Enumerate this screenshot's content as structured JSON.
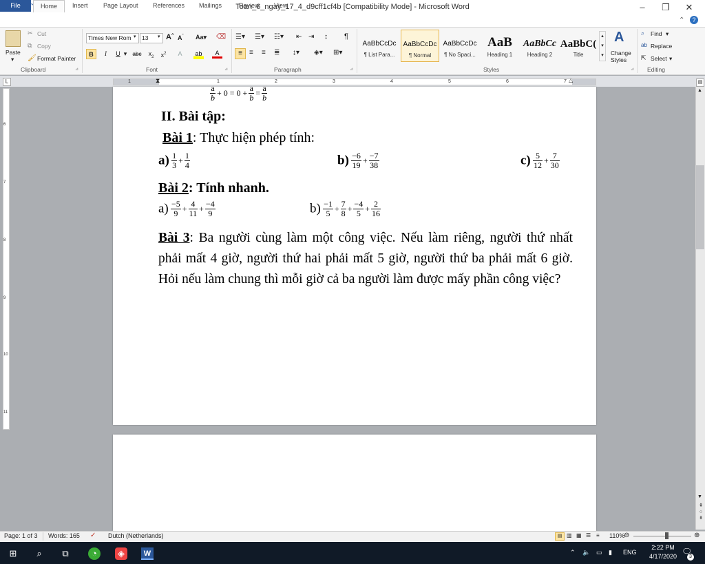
{
  "window": {
    "title": "Toan_6_ngay_17_4_d9cff1cf4b [Compatibility Mode] - Microsoft Word",
    "minimize_icon": "minimize-icon",
    "maximize_icon": "restore-icon",
    "close_icon": "close-icon"
  },
  "tabs": [
    "File",
    "Home",
    "Insert",
    "Page Layout",
    "References",
    "Mailings",
    "Review",
    "View"
  ],
  "ribbon": {
    "clipboard": {
      "paste": "Paste",
      "cut": "Cut",
      "copy": "Copy",
      "format_painter": "Format Painter",
      "group_label": "Clipboard"
    },
    "font": {
      "font_name": "Times New Rom",
      "font_size": "13",
      "group_label": "Font"
    },
    "paragraph": {
      "group_label": "Paragraph"
    },
    "styles": {
      "items": [
        {
          "preview": "AaBbCcDc",
          "name": "¶ List Para..."
        },
        {
          "preview": "AaBbCcDc",
          "name": "¶ Normal"
        },
        {
          "preview": "AaBbCcDc",
          "name": "¶ No Spaci..."
        },
        {
          "preview": "AaB",
          "name": "Heading 1"
        },
        {
          "preview": "AaBbCc",
          "name": "Heading 2"
        },
        {
          "preview": "AaBbC(",
          "name": "Title"
        }
      ],
      "change_styles_1": "Change",
      "change_styles_2": "Styles",
      "group_label": "Styles"
    },
    "editing": {
      "find": "Find",
      "replace": "Replace",
      "select": "Select",
      "group_label": "Editing"
    }
  },
  "ruler": {
    "h_numbers": [
      "1",
      "1",
      "2",
      "3",
      "4",
      "5",
      "6",
      "7"
    ],
    "v_numbers": [
      "6",
      "7",
      "8",
      "9",
      "10",
      "11"
    ]
  },
  "document": {
    "top_formula": {
      "a": "a",
      "b": "b",
      "mid": "+ 0 = 0 +",
      "eq": "="
    },
    "section_heading": "II. Bài tập:",
    "bai1": {
      "title": "Bài 1",
      "text": ": Thực hiện phép tính:",
      "a_label": "a)",
      "a": [
        {
          "n": "1",
          "d": "3"
        },
        {
          "n": "1",
          "d": "4"
        }
      ],
      "b_label": "b)",
      "b": [
        {
          "n": "−6",
          "d": "19"
        },
        {
          "n": "−7",
          "d": "38"
        }
      ],
      "c_label": "c)",
      "c": [
        {
          "n": "5",
          "d": "12"
        },
        {
          "n": "7",
          "d": "30"
        }
      ]
    },
    "bai2": {
      "title": "Bài 2",
      "text": ": Tính nhanh.",
      "a_label": "a)",
      "a": [
        {
          "n": "−5",
          "d": "9"
        },
        {
          "n": "4",
          "d": "11"
        },
        {
          "n": "−4",
          "d": "9"
        }
      ],
      "b_label": "b)",
      "b": [
        {
          "n": "−1",
          "d": "5"
        },
        {
          "n": "7",
          "d": "8"
        },
        {
          "n": "−4",
          "d": "5"
        },
        {
          "n": "2",
          "d": "16"
        }
      ]
    },
    "bai3": {
      "title": "Bài 3",
      "text": ": Ba người cùng làm  một công việc. Nếu làm riêng, người thứ nhất phải mất 4 giờ, người thứ hai phải mất 5 giờ, người thứ ba phải mất 6 giờ. Hỏi nếu làm chung thì mỗi giờ cả ba người làm được mấy phần công việc?"
    }
  },
  "status": {
    "page": "Page: 1 of 3",
    "words": "Words: 165",
    "language": "Dutch (Netherlands)",
    "zoom": "110%"
  },
  "taskbar": {
    "lang": "ENG",
    "time": "2:22 PM",
    "date": "4/17/2020",
    "notifications": "3"
  }
}
